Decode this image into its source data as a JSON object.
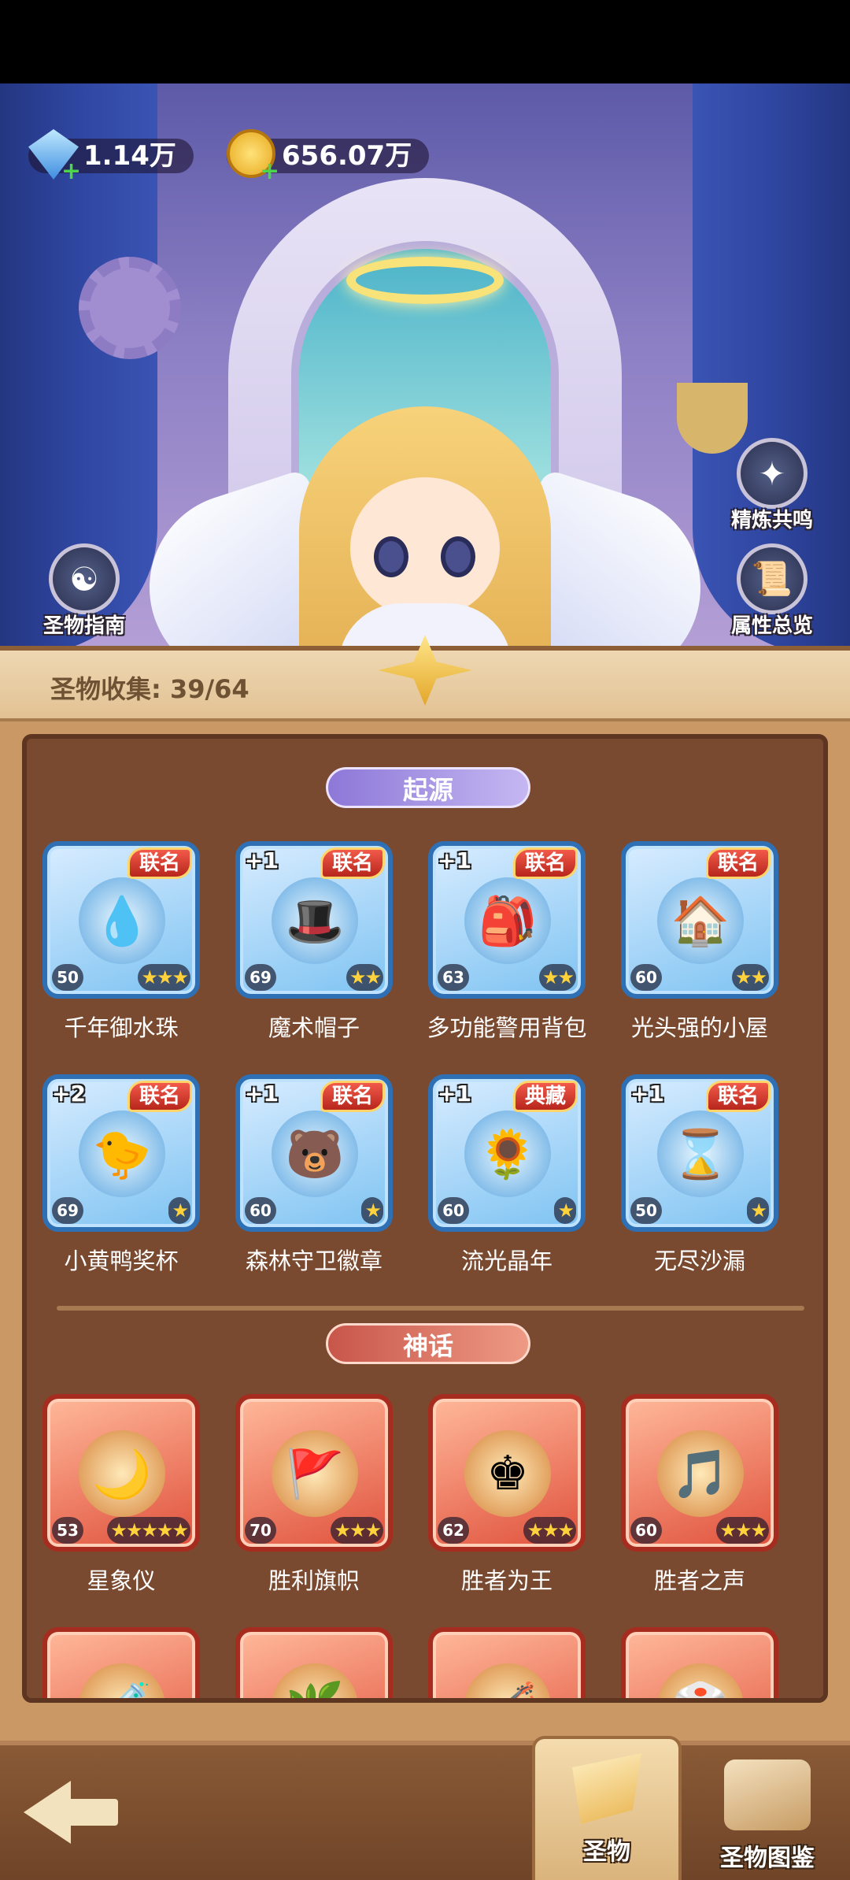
{
  "currency": {
    "gems": "1.14万",
    "gold": "656.07万"
  },
  "side_buttons": {
    "refine": "精炼共鸣",
    "guide": "圣物指南",
    "attributes": "属性总览"
  },
  "collection": {
    "label": "圣物收集: 39/64"
  },
  "sections": [
    {
      "title": "起源",
      "theme": "blue",
      "items": [
        {
          "name": "千年御水珠",
          "tag": "联名",
          "plus": "",
          "level": "50",
          "stars": "★★★",
          "icon": "water-orb-icon",
          "glyph": "💧"
        },
        {
          "name": "魔术帽子",
          "tag": "联名",
          "plus": "+1",
          "level": "69",
          "stars": "★★",
          "icon": "magic-hat-icon",
          "glyph": "🎩"
        },
        {
          "name": "多功能警用背包",
          "tag": "联名",
          "plus": "+1",
          "level": "63",
          "stars": "★★",
          "icon": "backpack-icon",
          "glyph": "🎒"
        },
        {
          "name": "光头强的小屋",
          "tag": "联名",
          "plus": "",
          "level": "60",
          "stars": "★★",
          "icon": "cabin-icon",
          "glyph": "🏠"
        },
        {
          "name": "小黄鸭奖杯",
          "tag": "联名",
          "plus": "+2",
          "level": "69",
          "stars": "★",
          "icon": "duck-trophy-icon",
          "glyph": "🐤"
        },
        {
          "name": "森林守卫徽章",
          "tag": "联名",
          "plus": "+1",
          "level": "60",
          "stars": "★",
          "icon": "bear-badge-icon",
          "glyph": "🐻"
        },
        {
          "name": "流光晶年",
          "tag": "典藏",
          "plus": "+1",
          "level": "60",
          "stars": "★",
          "icon": "snow-globe-icon",
          "glyph": "🌻"
        },
        {
          "name": "无尽沙漏",
          "tag": "联名",
          "plus": "+1",
          "level": "50",
          "stars": "★",
          "icon": "hourglass-icon",
          "glyph": "⌛"
        }
      ]
    },
    {
      "title": "神话",
      "theme": "red",
      "items": [
        {
          "name": "星象仪",
          "tag": "",
          "plus": "",
          "level": "53",
          "stars": "★★★★★",
          "icon": "astrolabe-icon",
          "glyph": "🌙"
        },
        {
          "name": "胜利旗帜",
          "tag": "",
          "plus": "",
          "level": "70",
          "stars": "★★★",
          "icon": "banner-icon",
          "glyph": "🚩"
        },
        {
          "name": "胜者为王",
          "tag": "",
          "plus": "",
          "level": "62",
          "stars": "★★★",
          "icon": "chess-king-icon",
          "glyph": "♚"
        },
        {
          "name": "胜者之声",
          "tag": "",
          "plus": "",
          "level": "60",
          "stars": "★★★",
          "icon": "flute-icon",
          "glyph": "🎵"
        },
        {
          "name": "",
          "tag": "",
          "plus": "",
          "level": "",
          "stars": "",
          "icon": "potion-icon",
          "glyph": "🧪"
        },
        {
          "name": "",
          "tag": "",
          "plus": "",
          "level": "",
          "stars": "",
          "icon": "leaf-icon",
          "glyph": "🌿"
        },
        {
          "name": "",
          "tag": "",
          "plus": "",
          "level": "",
          "stars": "",
          "icon": "harp-icon",
          "glyph": "🎻"
        },
        {
          "name": "",
          "tag": "",
          "plus": "",
          "level": "",
          "stars": "",
          "icon": "dice-icon",
          "glyph": "🎲"
        }
      ]
    }
  ],
  "bottom_tabs": {
    "relics": "圣物",
    "codex": "圣物图鉴"
  }
}
